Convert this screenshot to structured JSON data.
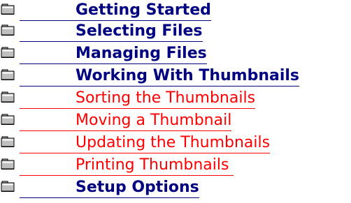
{
  "help": {
    "colors": {
      "chapter_link": "#000080",
      "subtopic_link": "#ff0000",
      "background": "#ffffff"
    },
    "icon": "closed-book-folder-icon",
    "topics": [
      {
        "label": "Getting Started",
        "level": "chapter"
      },
      {
        "label": "Selecting Files",
        "level": "chapter"
      },
      {
        "label": "Managing Files",
        "level": "chapter"
      },
      {
        "label": "Working With Thumbnails",
        "level": "chapter"
      },
      {
        "label": "Sorting the Thumbnails",
        "level": "subtopic"
      },
      {
        "label": "Moving a Thumbnail",
        "level": "subtopic"
      },
      {
        "label": "Updating the Thumbnails",
        "level": "subtopic"
      },
      {
        "label": "Printing Thumbnails ",
        "level": "subtopic"
      },
      {
        "label": "Setup Options",
        "level": "chapter"
      }
    ]
  }
}
